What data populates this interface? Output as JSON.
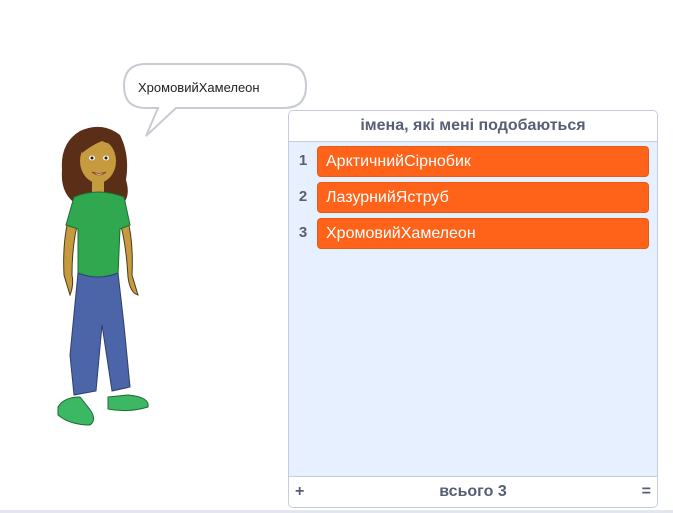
{
  "speech_bubble": {
    "text": "ХромовийХамелеон"
  },
  "list_monitor": {
    "title": "імена, які мені подобаються",
    "items": [
      {
        "index": "1",
        "value": "АрктичнийСірнобик"
      },
      {
        "index": "2",
        "value": "ЛазурнийЯструб"
      },
      {
        "index": "3",
        "value": "ХромовийХамелеон"
      }
    ],
    "add_label": "+",
    "length_label": "всього 3",
    "resize_label": "="
  },
  "colors": {
    "item_bg": "#ff6319",
    "monitor_bg": "#e6f0ff",
    "text_gray": "#575e75"
  }
}
